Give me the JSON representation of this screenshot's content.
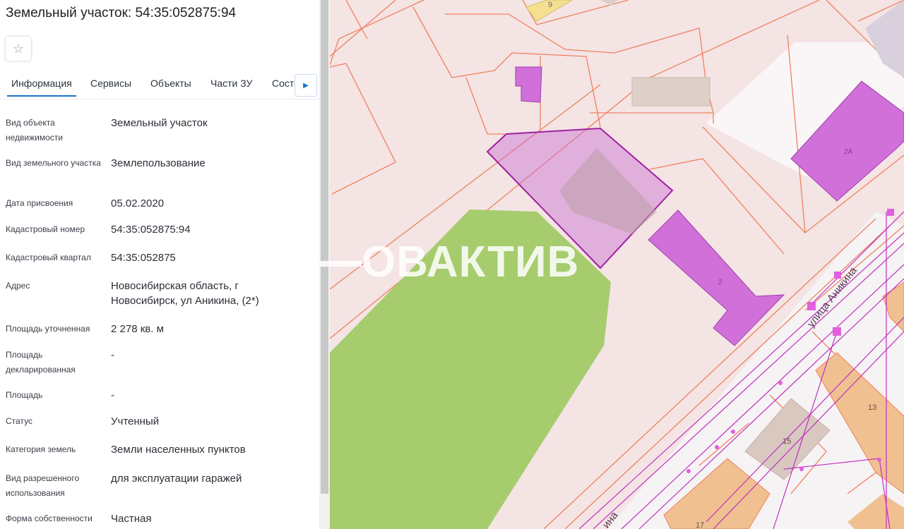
{
  "title": "Земельный участок: 54:35:052875:94",
  "favorite_icon": "star-outline-icon",
  "tabs": [
    {
      "label": "Информация"
    },
    {
      "label": "Сервисы"
    },
    {
      "label": "Объекты"
    },
    {
      "label": "Части ЗУ"
    },
    {
      "label": "Соста"
    }
  ],
  "fields": [
    {
      "label": "Вид объекта недвижимости",
      "value": "Земельный участок"
    },
    {
      "label": "Вид земельного участка",
      "value": "Землепользование"
    },
    {
      "label": "Дата присвоения",
      "value": "05.02.2020"
    },
    {
      "label": "Кадастровый номер",
      "value": "54:35:052875:94"
    },
    {
      "label": "Кадастровый квартал",
      "value": "54:35:052875"
    },
    {
      "label": "Адрес",
      "value": "Новосибирская область, г Новосибирск, ул Аникина, (2*)"
    },
    {
      "label": "Площадь уточненная",
      "value": "2 278 кв. м"
    },
    {
      "label": "Площадь декларированная",
      "value": "-"
    },
    {
      "label": "Площадь",
      "value": "-"
    },
    {
      "label": "Статус",
      "value": "Учтенный"
    },
    {
      "label": "Категория земель",
      "value": "Земли населенных пунктов"
    },
    {
      "label": "Вид разрешенного использования",
      "value": "для эксплуатации гаражей"
    },
    {
      "label": "Форма собственности",
      "value": "Частная"
    }
  ],
  "map": {
    "watermark": "ОВАКТИВ",
    "street_label": "улица Аникина",
    "street_label_bottom": "ина",
    "building_numbers": [
      "9",
      "2А",
      "2",
      "13",
      "15",
      "17"
    ],
    "colors": {
      "parcel_fill": "#f4e4e4",
      "parcel_border": "#f08060",
      "selected_parcel": "#a020a0",
      "building_magenta": "#d070d8",
      "green_area": "#a6cc6e",
      "orange_building": "#f0c090",
      "grey_building": "#d8c8c0"
    }
  }
}
